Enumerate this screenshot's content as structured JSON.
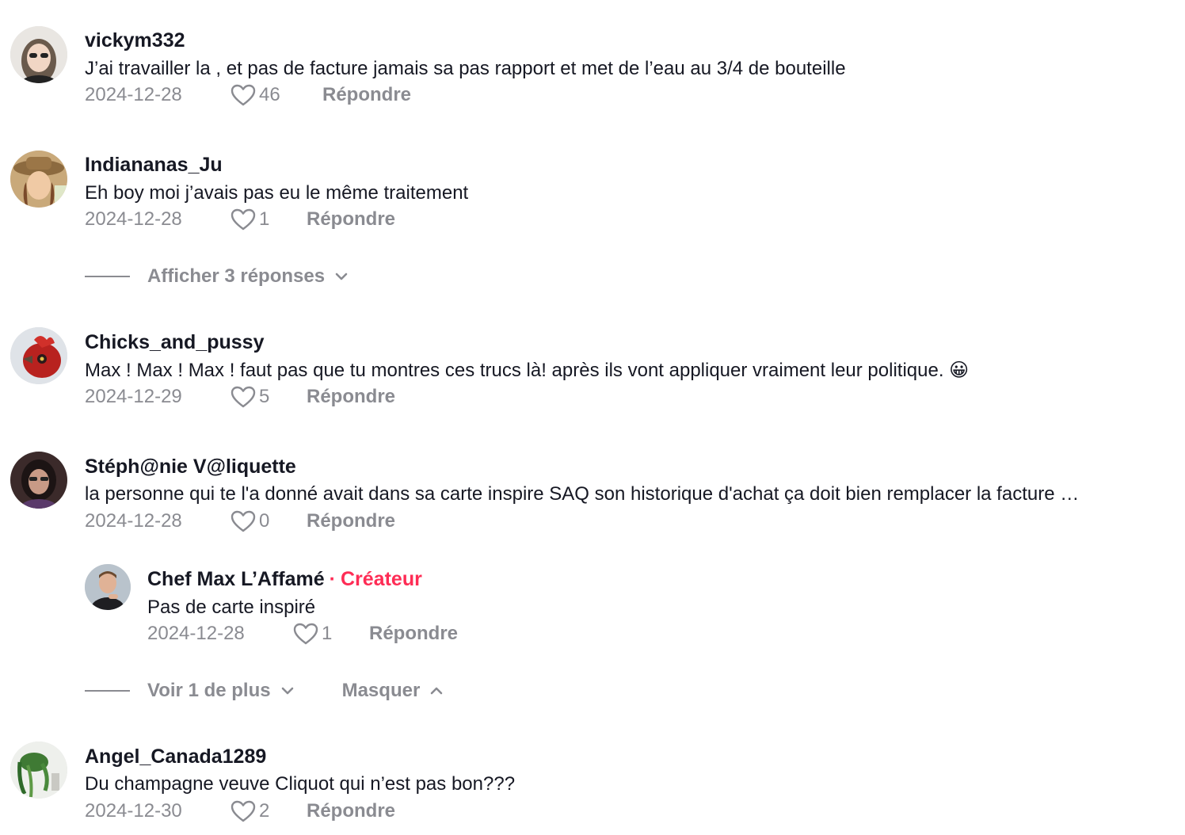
{
  "comments": [
    {
      "username": "vickym332",
      "text": "J’ai travailler la , et pas de facture jamais sa pas rapport et met de l’eau au 3/4 de bouteille",
      "date": "2024-12-28",
      "likes": "46",
      "reply": "Répondre"
    },
    {
      "username": "Indiananas_Ju",
      "text": "Eh boy moi j’avais pas eu le même traitement",
      "date": "2024-12-28",
      "likes": "1",
      "reply": "Répondre"
    },
    {
      "username": "Chicks_and_pussy",
      "text": "Max ! Max ! Max ! faut pas que tu montres ces trucs là! après ils vont appliquer vraiment leur politique. 😀",
      "date": "2024-12-29",
      "likes": "5",
      "reply": "Répondre"
    },
    {
      "username": "Stéph@nie V@liquette",
      "text": "la personne qui te l'a donné avait dans sa carte inspire SAQ son historique d'achat ça doit bien remplacer la facture …",
      "date": "2024-12-28",
      "likes": "0",
      "reply": "Répondre"
    },
    {
      "username": "Angel_Canada1289",
      "text": "Du champagne veuve Cliquot qui n’est pas bon???",
      "date": "2024-12-30",
      "likes": "2",
      "reply": "Répondre"
    }
  ],
  "reply_comment": {
    "username": "Chef Max L’Affamé",
    "dot": "·",
    "badge": "Créateur",
    "text": "Pas de carte inspiré",
    "date": "2024-12-28",
    "likes": "1",
    "reply": "Répondre"
  },
  "threads": {
    "show_replies": "Afficher 3 réponses",
    "see_more": "Voir 1 de plus",
    "hide": "Masquer"
  },
  "colors": {
    "accent": "#fe2c55",
    "muted": "#8a8b91",
    "text": "#161823"
  }
}
